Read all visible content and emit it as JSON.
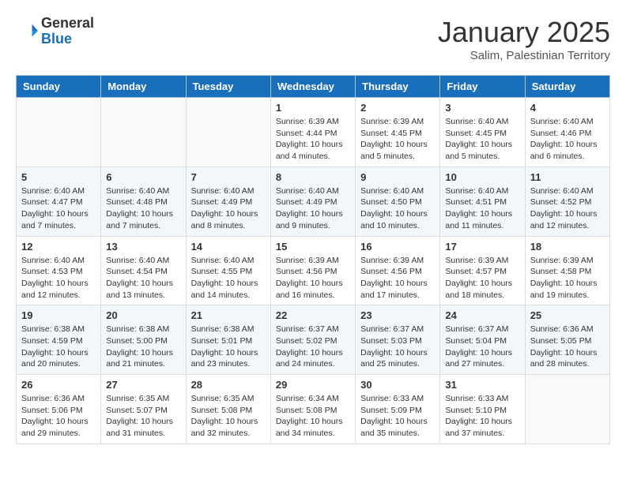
{
  "logo": {
    "general": "General",
    "blue": "Blue"
  },
  "title": "January 2025",
  "location": "Salim, Palestinian Territory",
  "days_of_week": [
    "Sunday",
    "Monday",
    "Tuesday",
    "Wednesday",
    "Thursday",
    "Friday",
    "Saturday"
  ],
  "weeks": [
    [
      {
        "day": "",
        "info": ""
      },
      {
        "day": "",
        "info": ""
      },
      {
        "day": "",
        "info": ""
      },
      {
        "day": "1",
        "info": "Sunrise: 6:39 AM\nSunset: 4:44 PM\nDaylight: 10 hours\nand 4 minutes."
      },
      {
        "day": "2",
        "info": "Sunrise: 6:39 AM\nSunset: 4:45 PM\nDaylight: 10 hours\nand 5 minutes."
      },
      {
        "day": "3",
        "info": "Sunrise: 6:40 AM\nSunset: 4:45 PM\nDaylight: 10 hours\nand 5 minutes."
      },
      {
        "day": "4",
        "info": "Sunrise: 6:40 AM\nSunset: 4:46 PM\nDaylight: 10 hours\nand 6 minutes."
      }
    ],
    [
      {
        "day": "5",
        "info": "Sunrise: 6:40 AM\nSunset: 4:47 PM\nDaylight: 10 hours\nand 7 minutes."
      },
      {
        "day": "6",
        "info": "Sunrise: 6:40 AM\nSunset: 4:48 PM\nDaylight: 10 hours\nand 7 minutes."
      },
      {
        "day": "7",
        "info": "Sunrise: 6:40 AM\nSunset: 4:49 PM\nDaylight: 10 hours\nand 8 minutes."
      },
      {
        "day": "8",
        "info": "Sunrise: 6:40 AM\nSunset: 4:49 PM\nDaylight: 10 hours\nand 9 minutes."
      },
      {
        "day": "9",
        "info": "Sunrise: 6:40 AM\nSunset: 4:50 PM\nDaylight: 10 hours\nand 10 minutes."
      },
      {
        "day": "10",
        "info": "Sunrise: 6:40 AM\nSunset: 4:51 PM\nDaylight: 10 hours\nand 11 minutes."
      },
      {
        "day": "11",
        "info": "Sunrise: 6:40 AM\nSunset: 4:52 PM\nDaylight: 10 hours\nand 12 minutes."
      }
    ],
    [
      {
        "day": "12",
        "info": "Sunrise: 6:40 AM\nSunset: 4:53 PM\nDaylight: 10 hours\nand 12 minutes."
      },
      {
        "day": "13",
        "info": "Sunrise: 6:40 AM\nSunset: 4:54 PM\nDaylight: 10 hours\nand 13 minutes."
      },
      {
        "day": "14",
        "info": "Sunrise: 6:40 AM\nSunset: 4:55 PM\nDaylight: 10 hours\nand 14 minutes."
      },
      {
        "day": "15",
        "info": "Sunrise: 6:39 AM\nSunset: 4:56 PM\nDaylight: 10 hours\nand 16 minutes."
      },
      {
        "day": "16",
        "info": "Sunrise: 6:39 AM\nSunset: 4:56 PM\nDaylight: 10 hours\nand 17 minutes."
      },
      {
        "day": "17",
        "info": "Sunrise: 6:39 AM\nSunset: 4:57 PM\nDaylight: 10 hours\nand 18 minutes."
      },
      {
        "day": "18",
        "info": "Sunrise: 6:39 AM\nSunset: 4:58 PM\nDaylight: 10 hours\nand 19 minutes."
      }
    ],
    [
      {
        "day": "19",
        "info": "Sunrise: 6:38 AM\nSunset: 4:59 PM\nDaylight: 10 hours\nand 20 minutes."
      },
      {
        "day": "20",
        "info": "Sunrise: 6:38 AM\nSunset: 5:00 PM\nDaylight: 10 hours\nand 21 minutes."
      },
      {
        "day": "21",
        "info": "Sunrise: 6:38 AM\nSunset: 5:01 PM\nDaylight: 10 hours\nand 23 minutes."
      },
      {
        "day": "22",
        "info": "Sunrise: 6:37 AM\nSunset: 5:02 PM\nDaylight: 10 hours\nand 24 minutes."
      },
      {
        "day": "23",
        "info": "Sunrise: 6:37 AM\nSunset: 5:03 PM\nDaylight: 10 hours\nand 25 minutes."
      },
      {
        "day": "24",
        "info": "Sunrise: 6:37 AM\nSunset: 5:04 PM\nDaylight: 10 hours\nand 27 minutes."
      },
      {
        "day": "25",
        "info": "Sunrise: 6:36 AM\nSunset: 5:05 PM\nDaylight: 10 hours\nand 28 minutes."
      }
    ],
    [
      {
        "day": "26",
        "info": "Sunrise: 6:36 AM\nSunset: 5:06 PM\nDaylight: 10 hours\nand 29 minutes."
      },
      {
        "day": "27",
        "info": "Sunrise: 6:35 AM\nSunset: 5:07 PM\nDaylight: 10 hours\nand 31 minutes."
      },
      {
        "day": "28",
        "info": "Sunrise: 6:35 AM\nSunset: 5:08 PM\nDaylight: 10 hours\nand 32 minutes."
      },
      {
        "day": "29",
        "info": "Sunrise: 6:34 AM\nSunset: 5:08 PM\nDaylight: 10 hours\nand 34 minutes."
      },
      {
        "day": "30",
        "info": "Sunrise: 6:33 AM\nSunset: 5:09 PM\nDaylight: 10 hours\nand 35 minutes."
      },
      {
        "day": "31",
        "info": "Sunrise: 6:33 AM\nSunset: 5:10 PM\nDaylight: 10 hours\nand 37 minutes."
      },
      {
        "day": "",
        "info": ""
      }
    ]
  ]
}
